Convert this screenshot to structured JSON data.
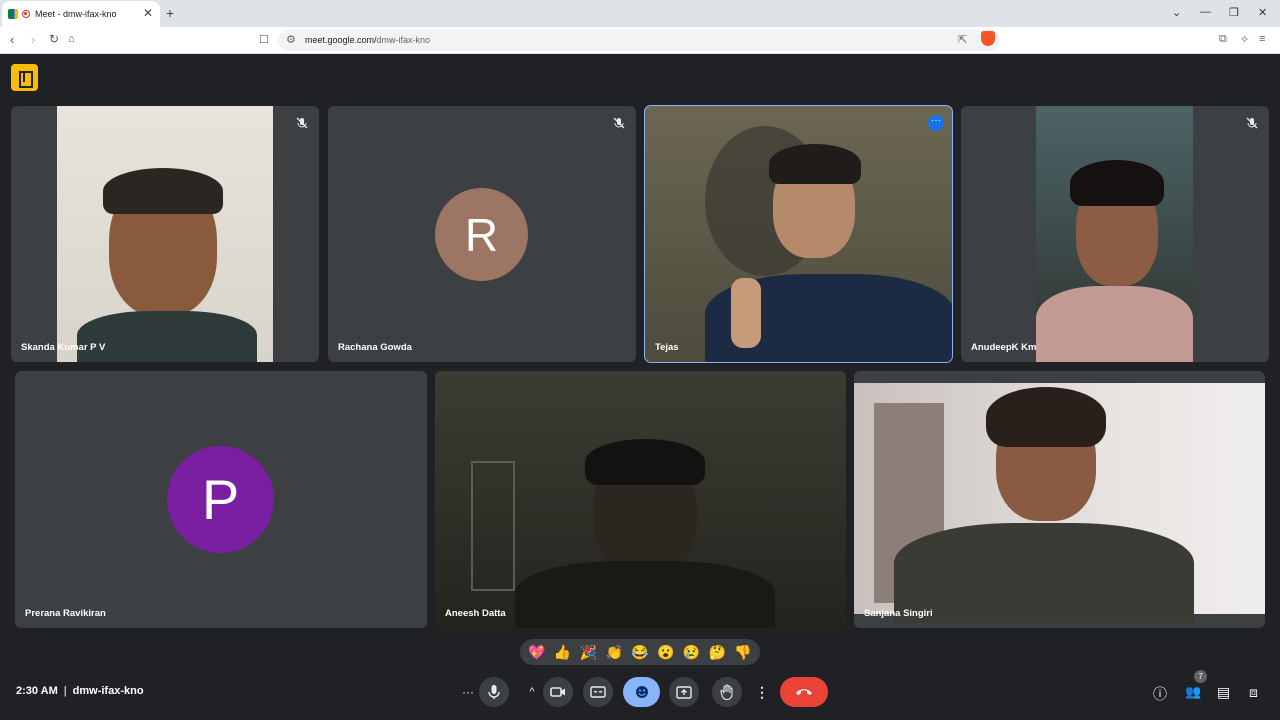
{
  "browser": {
    "tab_title": "Meet - dmw-ifax-kno",
    "url_host": "meet.google.com/",
    "url_path": "dmw-ifax-kno"
  },
  "participants": [
    {
      "name": "Skanda Kumar P V",
      "muted": true,
      "video": true
    },
    {
      "name": "Rachana Gowda",
      "muted": true,
      "video": false,
      "initial": "R",
      "avatar_color": "#9c7565"
    },
    {
      "name": "Tejas",
      "muted": false,
      "video": true,
      "speaking": true
    },
    {
      "name": "AnudeepK Km",
      "muted": true,
      "video": true
    },
    {
      "name": "Prerana Ravikiran",
      "muted": false,
      "video": false,
      "initial": "P",
      "avatar_color": "#7b1fa2"
    },
    {
      "name": "Aneesh Datta",
      "muted": false,
      "video": true
    },
    {
      "name": "Sanjana Singiri",
      "muted": false,
      "video": true
    }
  ],
  "reactions": [
    "💖",
    "👍",
    "🎉",
    "👏",
    "😂",
    "😮",
    "😢",
    "🤔",
    "👎"
  ],
  "footer": {
    "time": "2:30 AM",
    "separator": "|",
    "meeting_code": "dmw-ifax-kno",
    "people_count": "7"
  },
  "colors": {
    "accent": "#8ab4f8",
    "end_call": "#ea4335",
    "active_control": "#8ab4f8"
  }
}
